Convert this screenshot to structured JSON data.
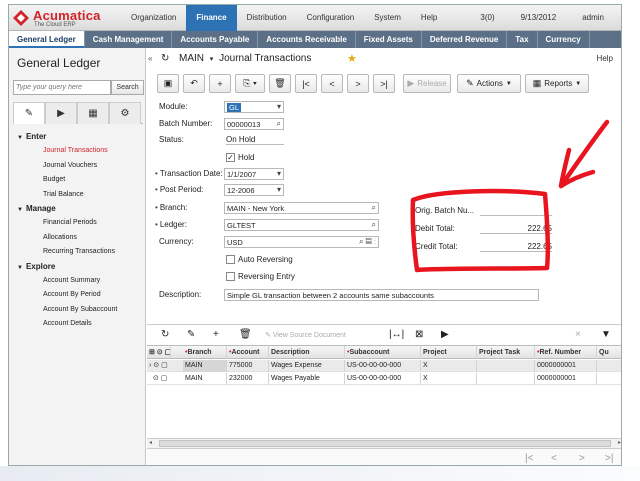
{
  "brand": {
    "name": "Acumatica",
    "tagline": "The Cloud ERP",
    "logo_color": "#d2232a"
  },
  "top_menu": [
    "Organization",
    "Finance",
    "Distribution",
    "Configuration",
    "System",
    "Help"
  ],
  "top_right": {
    "notifications": "3(0)",
    "date": "9/13/2012",
    "user": "admin"
  },
  "sub_menu": [
    "General Ledger",
    "Cash Management",
    "Accounts Payable",
    "Accounts Receivable",
    "Fixed Assets",
    "Deferred Revenue",
    "Tax",
    "Currency"
  ],
  "sidebar": {
    "title": "General Ledger",
    "search_placeholder": "Type your query here",
    "search_button": "Search",
    "tab_icons": [
      "pencil-icon",
      "play-icon",
      "report-icon",
      "gear-icon"
    ],
    "groups": [
      {
        "label": "Enter",
        "items": [
          "Journal Transactions",
          "Journal Vouchers",
          "Budget",
          "Trial Balance"
        ]
      },
      {
        "label": "Manage",
        "items": [
          "Financial Periods",
          "Allocations",
          "Recurring Transactions"
        ]
      },
      {
        "label": "Explore",
        "items": [
          "Account Summary",
          "Account By Period",
          "Account By Subaccount",
          "Account Details"
        ]
      }
    ],
    "active_item": "Journal Transactions"
  },
  "page": {
    "breadcrumb_root": "MAIN",
    "breadcrumb_sep": "▾",
    "title": "Journal Transactions",
    "help": "Help"
  },
  "toolbar": {
    "release": "Release",
    "actions": "Actions",
    "reports": "Reports"
  },
  "form": {
    "module": {
      "label": "Module:",
      "value": "GL"
    },
    "batch_number": {
      "label": "Batch Number:",
      "value": "00000013"
    },
    "status": {
      "label": "Status:",
      "value": "On Hold"
    },
    "hold": {
      "label": "Hold",
      "checked": true
    },
    "transaction_date": {
      "label": "Transaction Date:",
      "value": "1/1/2007"
    },
    "post_period": {
      "label": "Post Period:",
      "value": "12-2006"
    },
    "branch": {
      "label": "Branch:",
      "value": "MAIN - New York"
    },
    "ledger": {
      "label": "Ledger:",
      "value": "GLTEST"
    },
    "currency": {
      "label": "Currency:",
      "value": "USD"
    },
    "auto_reversing": {
      "label": "Auto Reversing",
      "checked": false
    },
    "reversing_entry": {
      "label": "Reversing Entry",
      "checked": false
    },
    "description": {
      "label": "Description:",
      "value": "Simple GL transaction between 2 accounts same subaccounts"
    },
    "orig_batch": {
      "label": "Orig. Batch Nu...",
      "value": ""
    },
    "debit_total": {
      "label": "Debit Total:",
      "value": "222.65"
    },
    "credit_total": {
      "label": "Credit Total:",
      "value": "222.65"
    }
  },
  "annotation_color": "#e8141e",
  "grid": {
    "toolbar_view_source": "View Source Document",
    "columns": [
      "Branch",
      "Account",
      "Description",
      "Subaccount",
      "Project",
      "Project Task",
      "Ref. Number",
      "Qu"
    ],
    "required_columns": [
      "Branch",
      "Account",
      "Subaccount",
      "Ref. Number"
    ],
    "rows": [
      {
        "branch": "MAIN",
        "account": "775000",
        "description": "Wages Expense",
        "subaccount": "US-00-00-00-000",
        "project": "X",
        "task": "",
        "ref": "0000000001"
      },
      {
        "branch": "MAIN",
        "account": "232000",
        "description": "Wages Payable",
        "subaccount": "US-00-00-00-000",
        "project": "X",
        "task": "",
        "ref": "0000000001"
      }
    ]
  }
}
